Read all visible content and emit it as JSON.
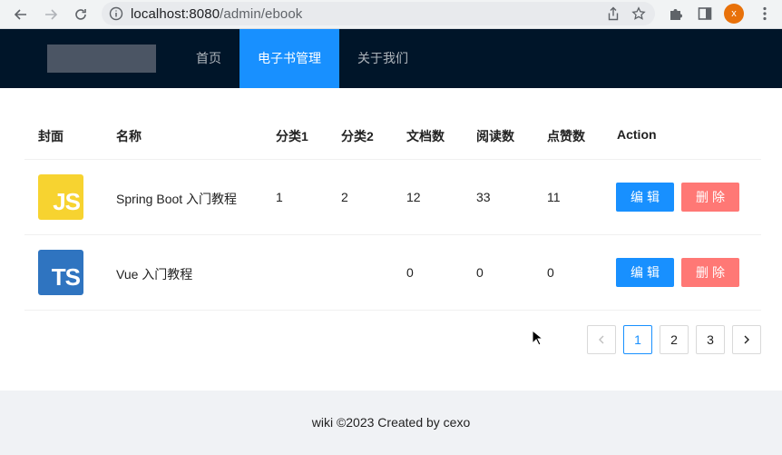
{
  "browser": {
    "url_host": "localhost:8080",
    "url_path": "/admin/ebook",
    "profile_initial": "x",
    "profile_color": "#e8710a"
  },
  "header": {
    "menu": [
      {
        "label": "首页",
        "active": false
      },
      {
        "label": "电子书管理",
        "active": true
      },
      {
        "label": "关于我们",
        "active": false
      }
    ],
    "accent": "#1890ff",
    "background": "#001529"
  },
  "table": {
    "columns": [
      "封面",
      "名称",
      "分类1",
      "分类2",
      "文档数",
      "阅读数",
      "点赞数",
      "Action"
    ],
    "rows": [
      {
        "cover_text": "JS",
        "cover_color": "#f7d330",
        "name": "Spring Boot 入门教程",
        "category1": "1",
        "category2": "2",
        "docs": "12",
        "views": "33",
        "likes": "11",
        "edit_label": "编辑",
        "delete_label": "删除"
      },
      {
        "cover_text": "TS",
        "cover_color": "#2f74c0",
        "name": "Vue 入门教程",
        "category1": "",
        "category2": "",
        "docs": "0",
        "views": "0",
        "likes": "0",
        "edit_label": "编辑",
        "delete_label": "删除"
      }
    ]
  },
  "pagination": {
    "pages": [
      "1",
      "2",
      "3"
    ],
    "current": "1"
  },
  "footer": {
    "text": "wiki ©2023 Created by cexo"
  }
}
